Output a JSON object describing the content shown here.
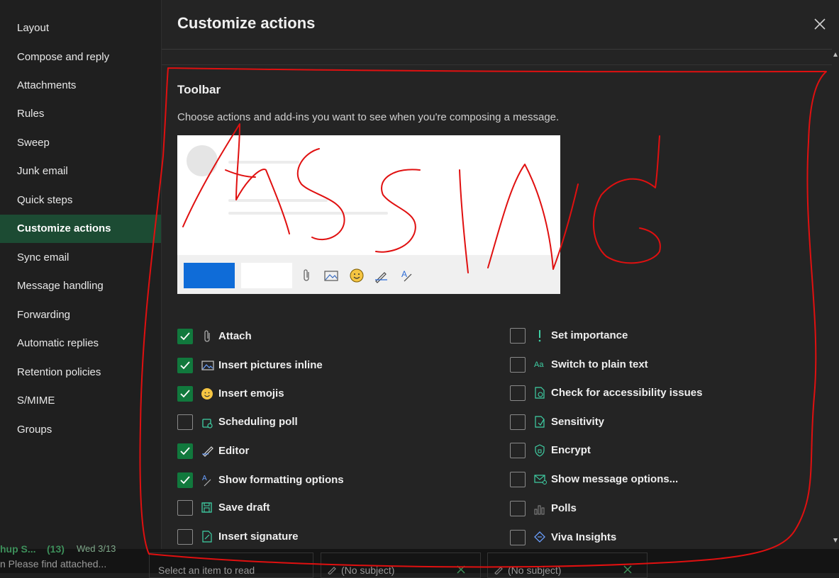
{
  "sidebar": {
    "items": [
      {
        "label": "Layout"
      },
      {
        "label": "Compose and reply"
      },
      {
        "label": "Attachments"
      },
      {
        "label": "Rules"
      },
      {
        "label": "Sweep"
      },
      {
        "label": "Junk email"
      },
      {
        "label": "Quick steps"
      },
      {
        "label": "Customize actions",
        "active": true
      },
      {
        "label": "Sync email"
      },
      {
        "label": "Message handling"
      },
      {
        "label": "Forwarding"
      },
      {
        "label": "Automatic replies"
      },
      {
        "label": "Retention policies"
      },
      {
        "label": "S/MIME"
      },
      {
        "label": "Groups"
      }
    ]
  },
  "dialog": {
    "title": "Customize actions",
    "section_title": "Toolbar",
    "section_desc": "Choose actions and add-ins you want to see when you're composing a message."
  },
  "options_left": [
    {
      "label": "Attach",
      "checked": true,
      "icon": "paperclip-icon"
    },
    {
      "label": "Insert pictures inline",
      "checked": true,
      "icon": "picture-icon"
    },
    {
      "label": "Insert emojis",
      "checked": true,
      "icon": "emoji-icon"
    },
    {
      "label": "Scheduling poll",
      "checked": false,
      "icon": "scheduling-poll-icon"
    },
    {
      "label": "Editor",
      "checked": true,
      "icon": "editor-pen-icon"
    },
    {
      "label": "Show formatting options",
      "checked": true,
      "icon": "formatting-icon"
    },
    {
      "label": "Save draft",
      "checked": false,
      "icon": "save-icon"
    },
    {
      "label": "Insert signature",
      "checked": false,
      "icon": "signature-icon"
    }
  ],
  "options_right": [
    {
      "label": "Set importance",
      "checked": false,
      "icon": "importance-icon"
    },
    {
      "label": "Switch to plain text",
      "checked": false,
      "icon": "plain-text-icon"
    },
    {
      "label": "Check for accessibility issues",
      "checked": false,
      "icon": "accessibility-icon"
    },
    {
      "label": "Sensitivity",
      "checked": false,
      "icon": "sensitivity-icon"
    },
    {
      "label": "Encrypt",
      "checked": false,
      "icon": "encrypt-shield-icon"
    },
    {
      "label": "Show message options...",
      "checked": false,
      "icon": "message-options-icon"
    },
    {
      "label": "Polls",
      "checked": false,
      "icon": "polls-icon"
    },
    {
      "label": "Viva Insights",
      "checked": false,
      "icon": "viva-insights-icon"
    }
  ],
  "background_strip": {
    "left_text_1": "hup S...",
    "count": "(13)",
    "date": "Wed 3/13",
    "left_text_2": "n Please find attached...",
    "reading_pane": "Select an item to read",
    "draft_1": "(No subject)",
    "draft_2": "(No subject)"
  },
  "annotation": {
    "text": "MISSING",
    "color": "#e01010"
  },
  "colors": {
    "accent_green": "#11793d",
    "active_nav": "#1c4b33",
    "send_blue": "#0f6cd8"
  }
}
